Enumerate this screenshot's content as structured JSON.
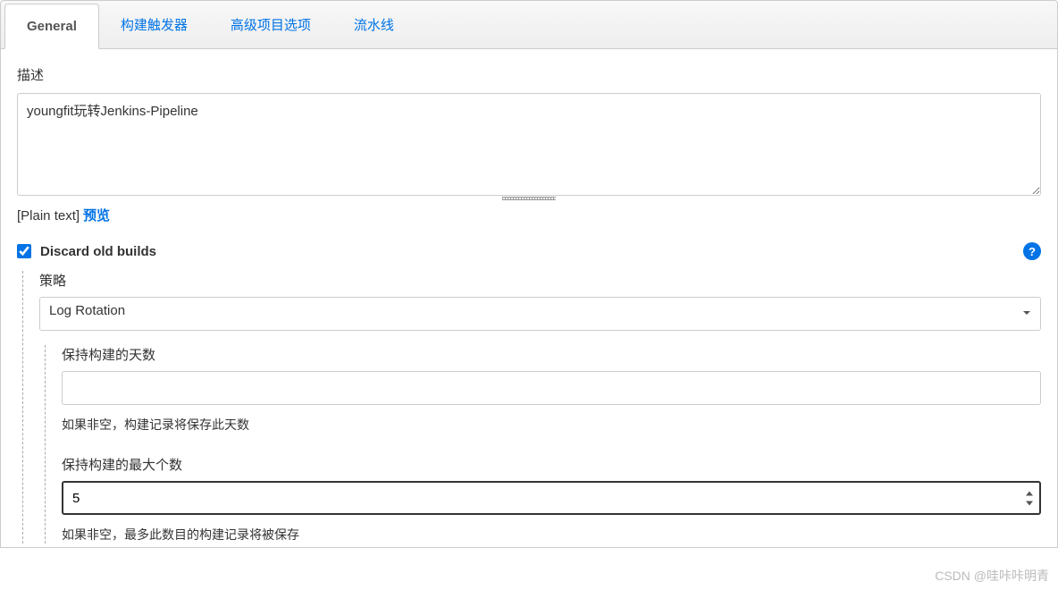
{
  "tabs": [
    {
      "label": "General",
      "active": true
    },
    {
      "label": "构建触发器",
      "active": false
    },
    {
      "label": "高级项目选项",
      "active": false
    },
    {
      "label": "流水线",
      "active": false
    }
  ],
  "description": {
    "label": "描述",
    "value": "youngfit玩转Jenkins-Pipeline"
  },
  "format": {
    "plain_text": "[Plain text]",
    "preview": "预览"
  },
  "discard": {
    "label": "Discard old builds",
    "checked": true,
    "help_icon": "?"
  },
  "strategy": {
    "label": "策略",
    "selected": "Log Rotation"
  },
  "days_to_keep": {
    "label": "保持构建的天数",
    "value": "",
    "help": "如果非空，构建记录将保存此天数"
  },
  "max_builds": {
    "label": "保持构建的最大个数",
    "value": "5",
    "help": "如果非空，最多此数目的构建记录将被保存"
  },
  "watermark": "CSDN @哇咔咔明青"
}
